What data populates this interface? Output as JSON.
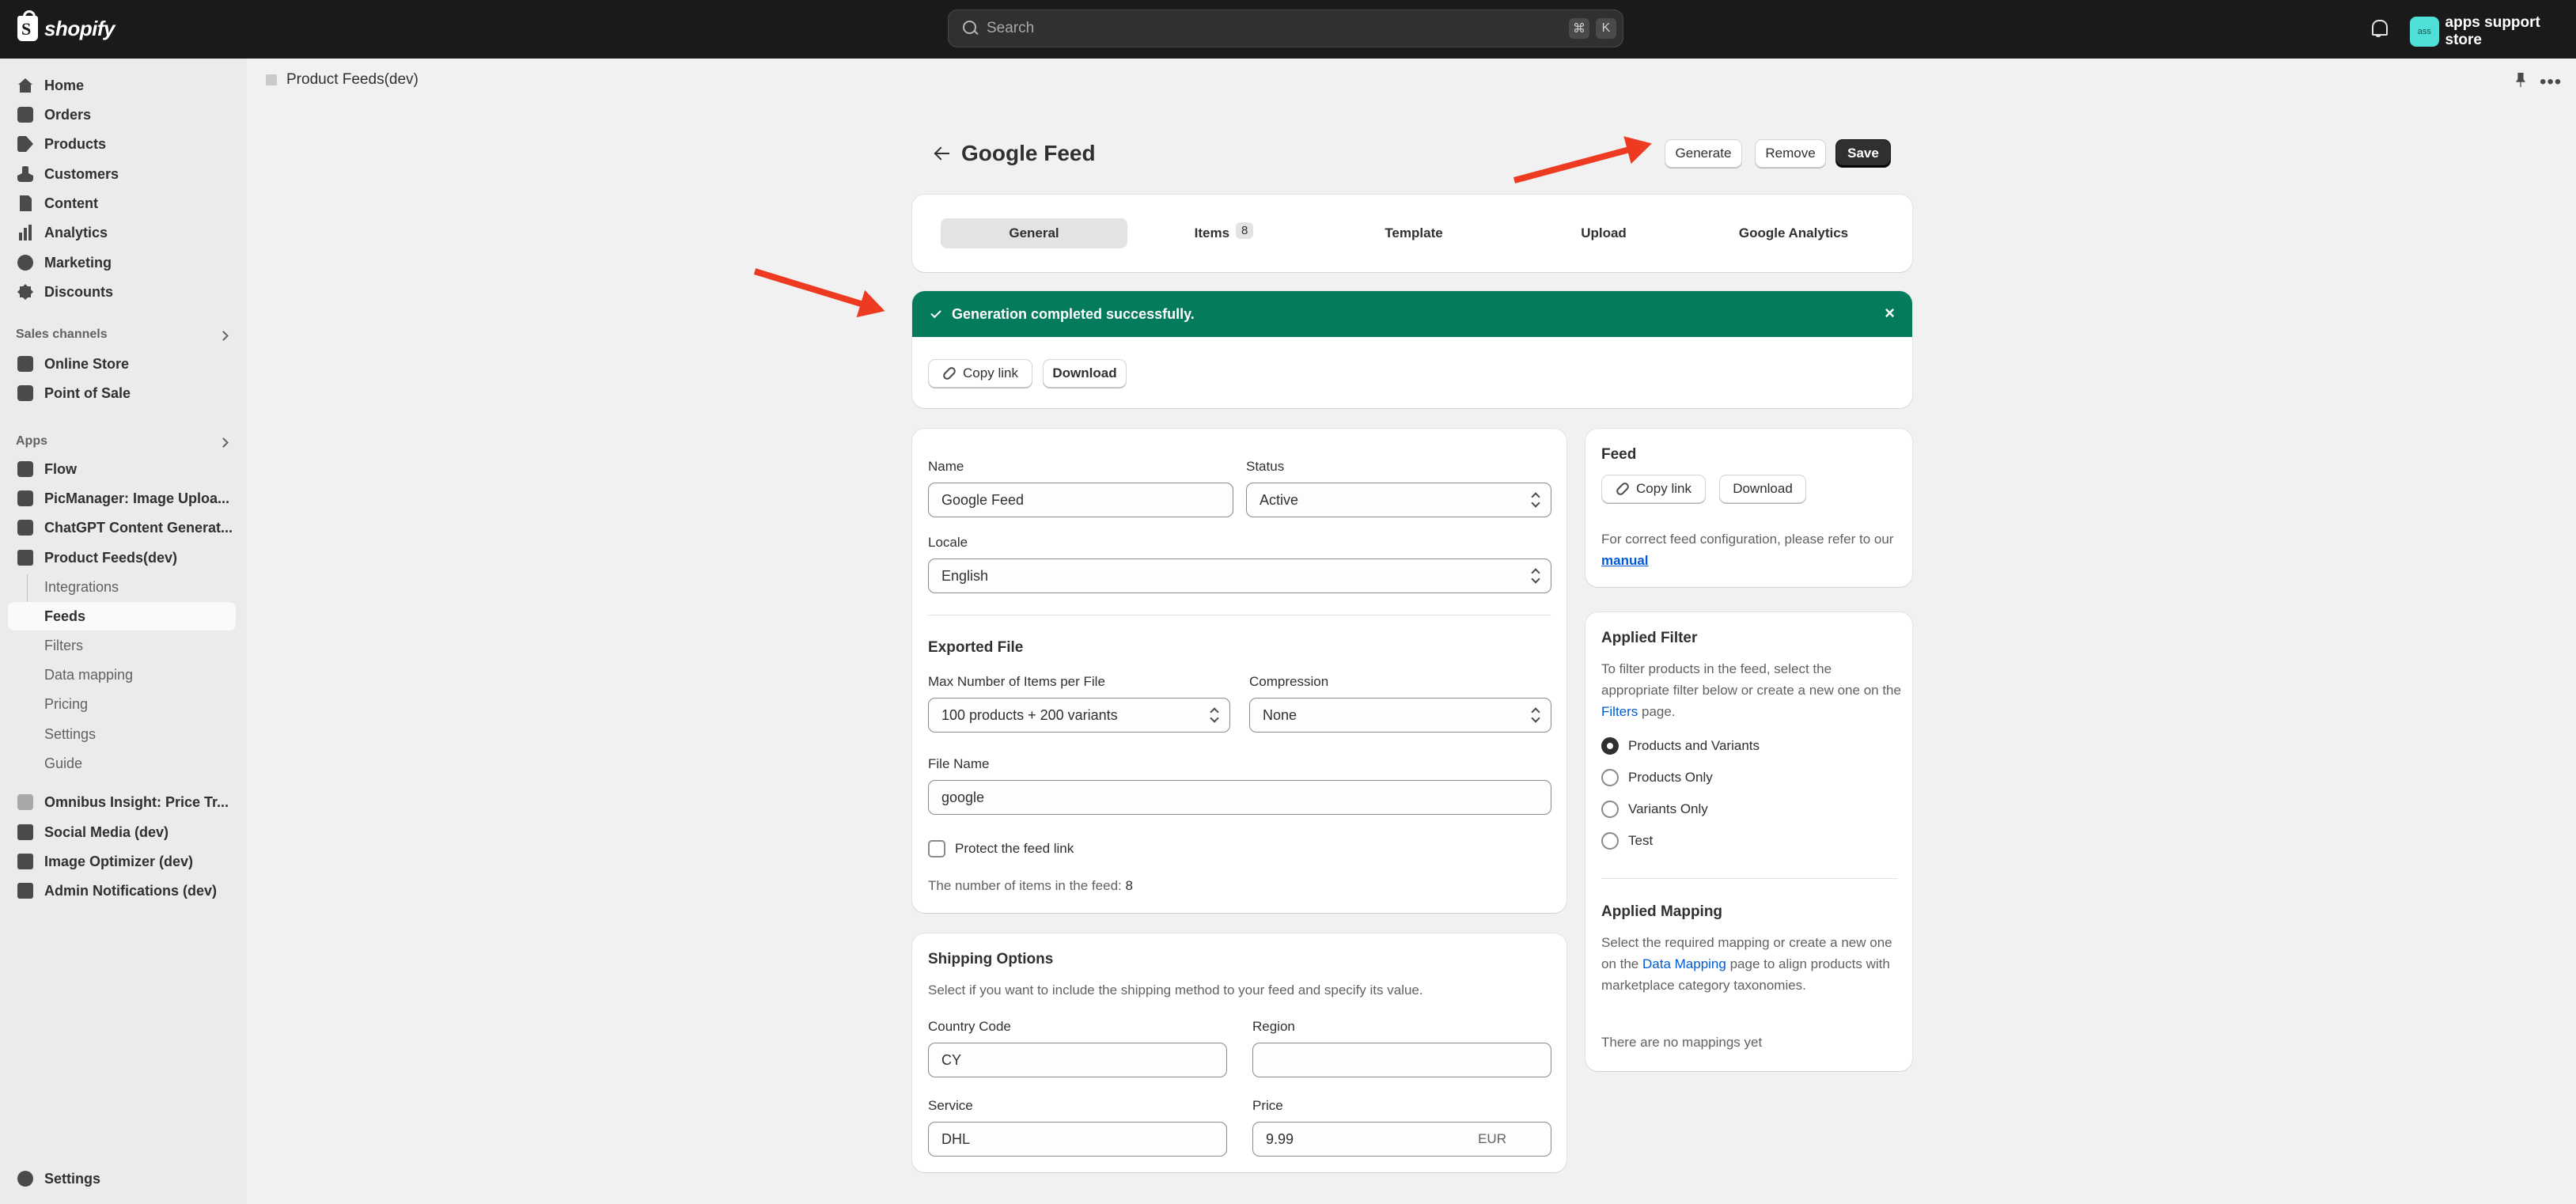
{
  "topbar": {
    "brand": "shopify",
    "search_placeholder": "Search",
    "shortcut_keys": [
      "⌘",
      "K"
    ],
    "store_initials": "ass",
    "store_name": "apps support store"
  },
  "sidebar": {
    "main": [
      "Home",
      "Orders",
      "Products",
      "Customers",
      "Content",
      "Analytics",
      "Marketing",
      "Discounts"
    ],
    "sales_channels_label": "Sales channels",
    "sales_channels": [
      "Online Store",
      "Point of Sale"
    ],
    "apps_label": "Apps",
    "apps": [
      "Flow",
      "PicManager: Image Uploa...",
      "ChatGPT Content Generat...",
      "Product Feeds(dev)"
    ],
    "app_subitems": [
      "Integrations",
      "Feeds",
      "Filters",
      "Data mapping",
      "Pricing",
      "Settings",
      "Guide"
    ],
    "more_apps": [
      "Omnibus Insight: Price Tr...",
      "Social Media (dev)",
      "Image Optimizer (dev)",
      "Admin Notifications (dev)"
    ],
    "settings": "Settings"
  },
  "breadcrumb": "Product Feeds(dev)",
  "page": {
    "title": "Google Feed",
    "actions": {
      "generate": "Generate",
      "remove": "Remove",
      "save": "Save"
    },
    "tabs": [
      "General",
      "Items",
      "Template",
      "Upload",
      "Google Analytics"
    ],
    "items_count": "8"
  },
  "banner": {
    "message": "Generation completed successfully.",
    "copy_link": "Copy link",
    "download": "Download"
  },
  "form": {
    "name_label": "Name",
    "name_value": "Google Feed",
    "status_label": "Status",
    "status_value": "Active",
    "locale_label": "Locale",
    "locale_value": "English",
    "exported_title": "Exported File",
    "max_items_label": "Max Number of Items per File",
    "max_items_value": "100 products + 200 variants",
    "compression_label": "Compression",
    "compression_value": "None",
    "file_name_label": "File Name",
    "file_name_value": "google",
    "protect_label": "Protect the feed link",
    "items_count_text": "The number of items in the feed:",
    "items_count_value": "8"
  },
  "shipping": {
    "title": "Shipping Options",
    "hint": "Select if you want to include the shipping method to your feed and specify its value.",
    "country_label": "Country Code",
    "country_value": "CY",
    "region_label": "Region",
    "region_value": "",
    "service_label": "Service",
    "service_value": "DHL",
    "price_label": "Price",
    "price_value": "9.99",
    "currency": "EUR"
  },
  "feed_card": {
    "title": "Feed",
    "copy_link": "Copy link",
    "download": "Download",
    "hint_prefix": "For correct feed configuration, please refer to our",
    "manual_link": "manual"
  },
  "filter_card": {
    "title": "Applied Filter",
    "hint_prefix": "To filter products in the feed, select the appropriate filter below or create a new one on the",
    "filters_link": "Filters",
    "hint_suffix": "page.",
    "options": [
      "Products and Variants",
      "Products Only",
      "Variants Only",
      "Test"
    ],
    "selected": "Products and Variants",
    "mapping_title": "Applied Mapping",
    "mapping_hint_prefix": "Select the required mapping or create a new one on the",
    "mapping_link": "Data Mapping",
    "mapping_hint_suffix": "page to align products with marketplace category taxonomies.",
    "empty": "There are no mappings yet"
  },
  "colors": {
    "topbar": "#1a1a1a",
    "success": "#047b5d",
    "annotation_arrow": "#ee3a20",
    "link": "#005bd3"
  }
}
